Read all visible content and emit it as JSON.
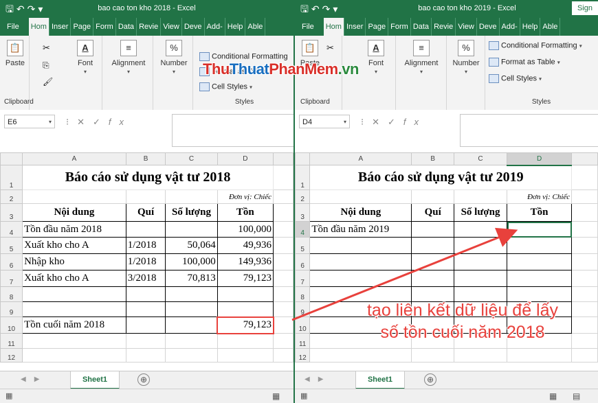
{
  "windows": [
    {
      "title": "bao cao ton kho 2018 - Excel",
      "tabs": [
        "File",
        "Hom",
        "Inser",
        "Page",
        "Form",
        "Data",
        "Revie",
        "View",
        "Deve",
        "Add-",
        "Help",
        "Able"
      ],
      "ribbon": {
        "clipboard": {
          "paste": "Paste",
          "label": "Clipboard"
        },
        "font": "Font",
        "alignment": "Alignment",
        "number": "Number",
        "styles": {
          "conditional": "Conditional Formatting",
          "format_table": "Format as Table",
          "cell_styles": "Cell Styles",
          "label": "Styles"
        }
      },
      "name_box": "E6",
      "fx": "fx",
      "columns": [
        "A",
        "B",
        "C",
        "D"
      ],
      "rows": [
        {
          "n": "1",
          "cells": [
            "Báo cáo sử dụng vật tư 2018"
          ]
        },
        {
          "n": "2",
          "cells": [
            "",
            "",
            "",
            "Đơn vị: Chiếc"
          ]
        },
        {
          "n": "3",
          "cells": [
            "Nội dung",
            "Quí",
            "Số lượng",
            "Tồn"
          ]
        },
        {
          "n": "4",
          "cells": [
            "Tồn đầu năm 2018",
            "",
            "",
            "100,000"
          ]
        },
        {
          "n": "5",
          "cells": [
            "Xuất kho cho A",
            "1/2018",
            "50,064",
            "49,936"
          ]
        },
        {
          "n": "6",
          "cells": [
            "Nhập kho",
            "1/2018",
            "100,000",
            "149,936"
          ]
        },
        {
          "n": "7",
          "cells": [
            "Xuất kho cho A",
            "3/2018",
            "70,813",
            "79,123"
          ]
        },
        {
          "n": "8",
          "cells": [
            "",
            "",
            "",
            ""
          ]
        },
        {
          "n": "9",
          "cells": [
            "",
            "",
            "",
            ""
          ]
        },
        {
          "n": "10",
          "cells": [
            "Tồn cuối năm 2018",
            "",
            "",
            "79,123"
          ]
        },
        {
          "n": "11",
          "cells": [
            "",
            "",
            "",
            ""
          ]
        },
        {
          "n": "12",
          "cells": [
            "",
            "",
            "",
            ""
          ]
        }
      ],
      "sheet": "Sheet1",
      "add_sheet": "⊕"
    },
    {
      "title": "bao cao ton kho 2019 - Excel",
      "signin": "Sign",
      "tabs": [
        "File",
        "Hom",
        "Inser",
        "Page",
        "Form",
        "Data",
        "Revie",
        "View",
        "Deve",
        "Add-",
        "Help",
        "Able"
      ],
      "ribbon": {
        "clipboard": {
          "paste": "Paste",
          "label": "Clipboard"
        },
        "font": "Font",
        "alignment": "Alignment",
        "number": "Number",
        "styles": {
          "conditional": "Conditional Formatting",
          "format_table": "Format as Table",
          "cell_styles": "Cell Styles",
          "label": "Styles"
        }
      },
      "name_box": "D4",
      "fx": "fx",
      "columns": [
        "A",
        "B",
        "C",
        "D"
      ],
      "rows": [
        {
          "n": "1",
          "cells": [
            "Báo cáo sử dụng vật tư 2019"
          ]
        },
        {
          "n": "2",
          "cells": [
            "",
            "",
            "",
            "Đơn vị: Chiếc"
          ]
        },
        {
          "n": "3",
          "cells": [
            "Nội dung",
            "Quí",
            "Số lượng",
            "Tồn"
          ]
        },
        {
          "n": "4",
          "cells": [
            "Tồn đầu năm 2019",
            "",
            "",
            ""
          ]
        },
        {
          "n": "5",
          "cells": [
            "",
            "",
            "",
            ""
          ]
        },
        {
          "n": "6",
          "cells": [
            "",
            "",
            "",
            ""
          ]
        },
        {
          "n": "7",
          "cells": [
            "",
            "",
            "",
            ""
          ]
        },
        {
          "n": "8",
          "cells": [
            "",
            "",
            "",
            ""
          ]
        },
        {
          "n": "9",
          "cells": [
            "",
            "",
            "",
            ""
          ]
        },
        {
          "n": "10",
          "cells": [
            "",
            "",
            "",
            ""
          ]
        },
        {
          "n": "11",
          "cells": [
            "",
            "",
            "",
            ""
          ]
        },
        {
          "n": "12",
          "cells": [
            "",
            "",
            "",
            ""
          ]
        }
      ],
      "sheet": "Sheet1",
      "add_sheet": "⊕"
    }
  ],
  "watermark": {
    "part1": "Thu",
    "part2": "Thuat",
    "part3": "PhanMem",
    "part4": ".vn"
  },
  "annotation": {
    "line1": "tạo liên kết dữ liệu để lấy",
    "line2": "số tồn cuối năm 2018"
  },
  "colors": {
    "excel_green": "#217346",
    "annotation_red": "#e8413c"
  }
}
